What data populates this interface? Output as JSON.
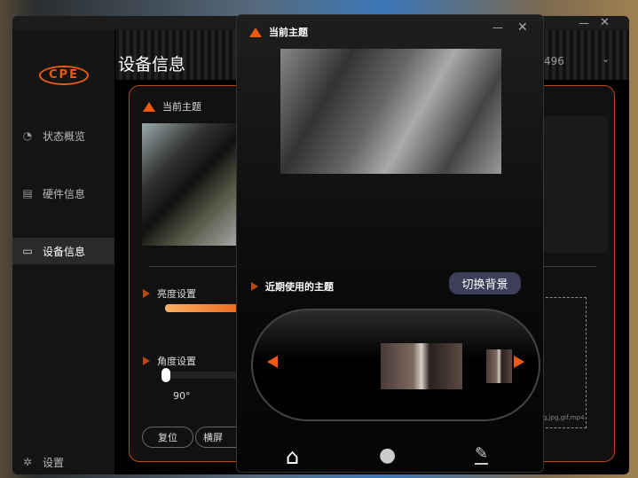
{
  "sidebar": {
    "logo": "CPE",
    "items": [
      {
        "label": "状态概览",
        "icon": "gauge-icon"
      },
      {
        "label": "硬件信息",
        "icon": "copy-icon"
      },
      {
        "label": "设备信息",
        "icon": "monitor-icon"
      }
    ],
    "settings": "设置"
  },
  "main": {
    "title": "设备信息",
    "dropdown_value": "496",
    "card": {
      "current_theme": "当前主题",
      "brightness": "亮度设置",
      "angle": "角度设置",
      "angle_value": "90°",
      "brightness_level": 0.7,
      "reset": "复位",
      "landscape": "横屏",
      "upload_hint": "g,jpg,gif,mp4"
    }
  },
  "popup": {
    "title": "当前主题",
    "recent": "近期使用的主题",
    "switch_bg": "切换背景",
    "minimize": "—",
    "close": "✕"
  },
  "window": {
    "minimize": "—",
    "close": "✕"
  },
  "colors": {
    "accent": "#ee5a12",
    "button": "#3d3f5a"
  }
}
